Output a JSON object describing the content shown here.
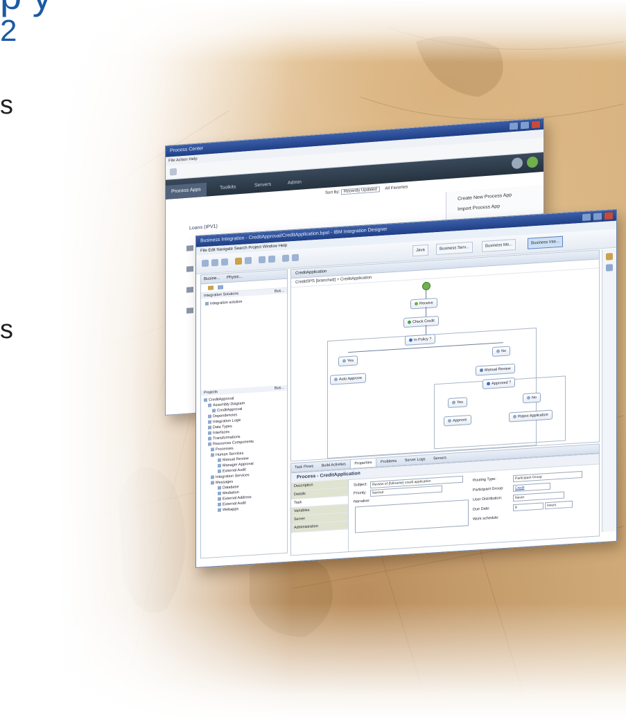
{
  "slide": {
    "title_line1": "p                                        y",
    "title_line2": "2",
    "bullet_frags": [
      "s",
      "s"
    ]
  },
  "process_center": {
    "title": "Process Center",
    "menu": "File  Action  Help",
    "tabs": [
      "Process Apps",
      "Toolkits",
      "Servers",
      "Admin"
    ],
    "sort_label": "Sort By:",
    "sort_value": "Recently Updated",
    "filter_label": "All Favorites",
    "create_link": "Create New Process App",
    "import_link": "Import Process App",
    "list_items": [
      "Loans (IPV1)",
      "",
      "",
      "",
      ""
    ],
    "colors": {
      "header": "#26333f",
      "accent": "#6fb14b"
    }
  },
  "ide": {
    "title": "Business Integration - CreditApproval/CreditApplication.bpel - IBM Integration Designer",
    "menu": "File  Edit  Navigate  Search  Project  Window  Help",
    "perspectives": [
      "Java",
      "Business Serv...",
      "Business Mo...",
      "Business Inte..."
    ],
    "left_tabs": [
      "Busine...",
      "Physic..."
    ],
    "integration_solutions_label": "Integration Solutions",
    "integration_solutions_more": "Bus...",
    "integration_solution_item": "Integration solution",
    "projects_label": "Projects",
    "projects_more": "Bus...",
    "tree": [
      "CreditApproval",
      "Assembly Diagram",
      "CreditApproval",
      "Dependencies",
      "Integration Logic",
      "Data Types",
      "Interfaces",
      "Transformations",
      "Resources Components",
      "Processes",
      "Human Services",
      "Manual Review",
      "Manager Approval",
      "External Audit",
      "Integration Services",
      "Messages",
      "Database",
      "Mediation",
      "External Address",
      "External Audit",
      "Webapps"
    ],
    "editor_tab": "CreditApplication",
    "breadcrumb": "CreditSPS [branched]  >  CreditApplication",
    "flow": {
      "receive": "Receive",
      "check_credit": "Check Credit",
      "decision1": "In Policy ?",
      "yes1": "Yes",
      "no1": "No",
      "auto_approve": "Auto Approve",
      "manual_review": "Manual Review",
      "decision2": "Approved ?",
      "yes2": "Yes",
      "no2": "No",
      "approve": "Approve",
      "reject": "Reject Application"
    },
    "bottom_tabs": [
      "Task Flows",
      "Build Activities",
      "Properties",
      "Problems",
      "Server Logs",
      "Servers"
    ],
    "props_title": "Process - CreditApplication",
    "props_nav": [
      "Description",
      "Details",
      "Task",
      "Variables",
      "Server",
      "Administration"
    ],
    "props": {
      "subject_label": "Subject:",
      "subject_value": "Review of {fullname} credit application",
      "priority_label": "Priority:",
      "priority_value": "Normal",
      "narrative_label": "Narrative:",
      "routing_label": "Routing Type:",
      "routing_value": "Participant Group",
      "participant_label": "Participant Group:",
      "participant_value": "Credit",
      "user_dist_label": "User Distribution:",
      "user_dist_value": "Never",
      "due_label": "Due Date:",
      "due_value": "8",
      "due_unit": "Hours",
      "work_schedule_label": "Work schedule:"
    }
  }
}
